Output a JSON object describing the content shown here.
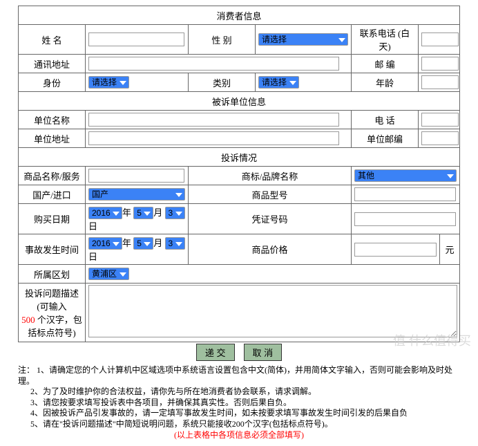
{
  "sec1": "消费者信息",
  "c": {
    "name": "姓 名",
    "sex": "性 别",
    "sex_ph": "请选择",
    "phone": "联系电话 (白天)",
    "addr": "通讯地址",
    "zip": "邮 编",
    "id": "身份",
    "id_ph": "请选择",
    "cat": "类别",
    "cat_ph": "请选择",
    "age": "年龄"
  },
  "sec2": "被诉单位信息",
  "u": {
    "name": "单位名称",
    "phone": "电 话",
    "addr": "单位地址",
    "zip": "单位邮编"
  },
  "sec3": "投诉情况",
  "p": {
    "goods": "商品名称/服务",
    "brand": "商标/品牌名称",
    "brand_v": "其他",
    "origin": "国产/进口",
    "origin_v": "国产",
    "model": "商品型号",
    "buydate": "购买日期",
    "voucher": "凭证号码",
    "accdate": "事故发生时间",
    "price": "商品价格",
    "yuan": "元",
    "area": "所属区划",
    "area_v": "黄浦区",
    "desc": {
      "l1": "投诉问题描述",
      "l2": "(可输入",
      "l3": "500",
      "l4": " 个汉字，包括标点符号)"
    }
  },
  "date": {
    "y": "2016",
    "yu": "年",
    "m": "5",
    "mu": "月",
    "d": "3",
    "du": "日"
  },
  "btn": {
    "submit": "递 交",
    "cancel": "取 消"
  },
  "notes": {
    "h": "注：",
    "n1": "1、请确定您的个人计算机中区域选项中系统语言设置包含中文(简体)，并用简体文字输入，否则可能会影响及时处理。",
    "n2": "2、为了及时维护你的合法权益，请你先与所在地消费者协会联系，请求调解。",
    "n3": "3、请您按要求填写投诉表中各项目，并确保其真实性。否则后果自负。",
    "n4": "4、因被投诉产品引发事故的，请一定填写事故发生时间，如未按要求填写事故发生时间引发的后果自负",
    "n5": "5、请在\"投诉问题描述\"中简短说明问题，系统只能接收200个汉字(包括标点符号)。",
    "n6": "(以上表格中各项信息必须全部填写)"
  },
  "wm": "值 什么值得买"
}
